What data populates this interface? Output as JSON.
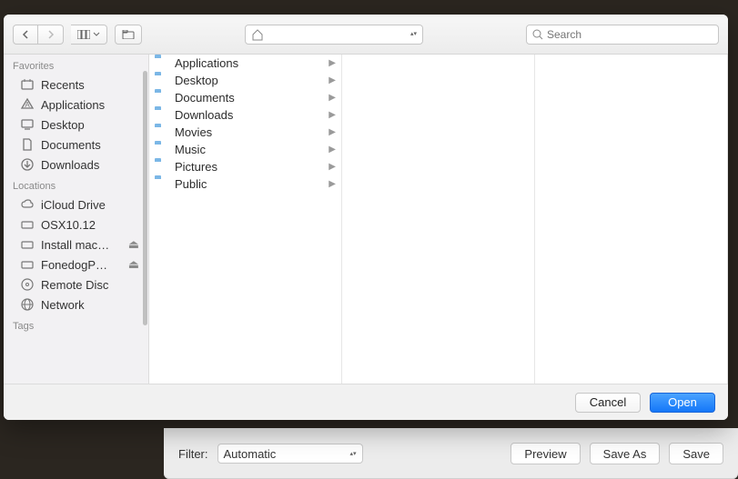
{
  "toolbar": {
    "path_label": "",
    "search_placeholder": "Search"
  },
  "sidebar": {
    "sections": [
      {
        "title": "Favorites",
        "items": [
          {
            "icon": "recents",
            "label": "Recents"
          },
          {
            "icon": "apps",
            "label": "Applications"
          },
          {
            "icon": "desktop",
            "label": "Desktop"
          },
          {
            "icon": "documents",
            "label": "Documents"
          },
          {
            "icon": "downloads",
            "label": "Downloads"
          }
        ]
      },
      {
        "title": "Locations",
        "items": [
          {
            "icon": "cloud",
            "label": "iCloud Drive"
          },
          {
            "icon": "disk",
            "label": "OSX10.12"
          },
          {
            "icon": "disk",
            "label": "Install mac…",
            "eject": true
          },
          {
            "icon": "disk",
            "label": "FonedogP…",
            "eject": true
          },
          {
            "icon": "disc",
            "label": "Remote Disc"
          },
          {
            "icon": "globe",
            "label": "Network"
          }
        ]
      },
      {
        "title": "Tags",
        "items": []
      }
    ]
  },
  "column1": [
    {
      "label": "Applications"
    },
    {
      "label": "Desktop"
    },
    {
      "label": "Documents"
    },
    {
      "label": "Downloads"
    },
    {
      "label": "Movies"
    },
    {
      "label": "Music"
    },
    {
      "label": "Pictures"
    },
    {
      "label": "Public"
    }
  ],
  "buttons": {
    "cancel": "Cancel",
    "open": "Open"
  },
  "background_bar": {
    "filter_label": "Filter:",
    "filter_value": "Automatic",
    "preview": "Preview",
    "saveas": "Save As",
    "save": "Save"
  }
}
